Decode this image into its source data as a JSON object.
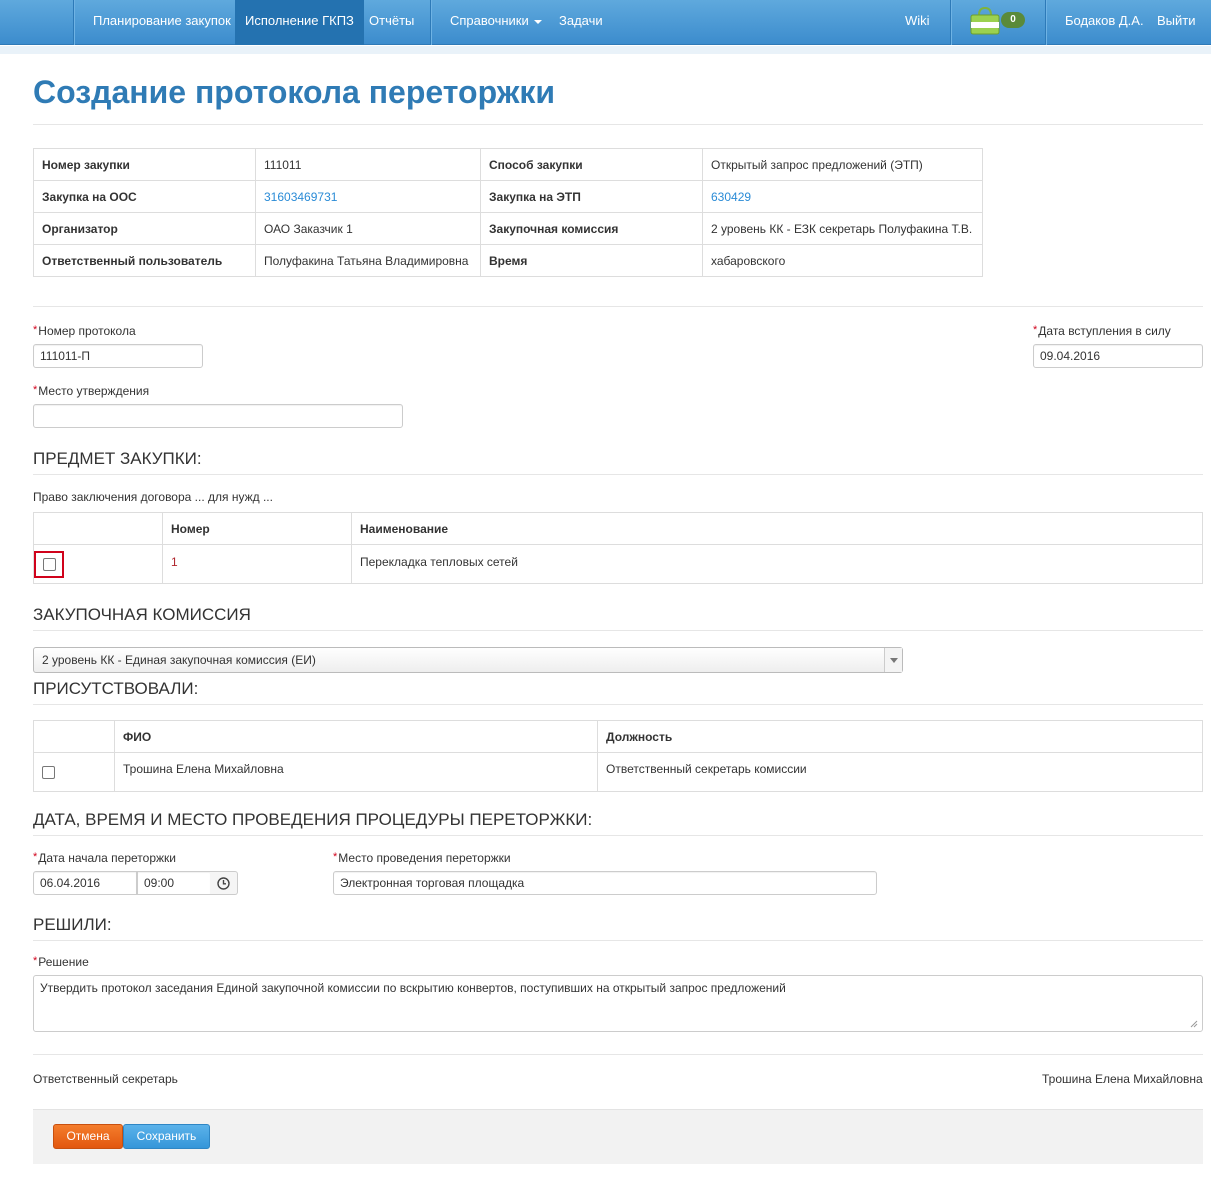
{
  "nav": {
    "items": [
      "Планирование закупок",
      "Исполнение ГКПЗ",
      "Отчёты",
      "Справочники",
      "Задачи"
    ],
    "wiki": "Wiki",
    "cart_count": "0",
    "user": "Бодаков Д.А.",
    "logout": "Выйти"
  },
  "page": {
    "title": "Создание протокола переторжки"
  },
  "info": {
    "rows": [
      [
        "Номер закупки",
        "111011",
        "Способ закупки",
        "Открытый запрос предложений (ЭТП)"
      ],
      [
        "Закупка на ООС",
        "31603469731",
        "Закупка на ЭТП",
        "630429"
      ],
      [
        "Организатор",
        "ОАО Заказчик 1",
        "Закупочная комиссия",
        "2 уровень КК - ЕЗК секретарь Полуфакина Т.В."
      ],
      [
        "Ответственный пользователь",
        "Полуфакина Татьяна Владимировна",
        "Время",
        "хабаровского"
      ]
    ]
  },
  "form": {
    "required_mark": "*",
    "protocol_number": {
      "label": "Номер протокола",
      "value": "111011-П"
    },
    "effective_date": {
      "label": "Дата вступления в силу",
      "value": "09.04.2016"
    },
    "approval_place": {
      "label": "Место утверждения",
      "value": ""
    }
  },
  "subject": {
    "heading": "ПРЕДМЕТ ЗАКУПКИ:",
    "description": "Право заключения договора ... для нужд ...",
    "columns": [
      "",
      "Номер",
      "Наименование"
    ],
    "rows": [
      {
        "number": "1",
        "name": "Перекладка тепловых сетей"
      }
    ]
  },
  "commission": {
    "heading": "ЗАКУПОЧНАЯ КОМИССИЯ",
    "selected": "2 уровень КК - Единая закупочная комиссия (ЕИ)"
  },
  "attended": {
    "heading": "ПРИСУТСТВОВАЛИ:",
    "columns": [
      "",
      "ФИО",
      "Должность"
    ],
    "rows": [
      {
        "name": "Трошина Елена Михайловна",
        "position": "Ответственный секретарь комиссии"
      }
    ]
  },
  "rebid": {
    "heading": "ДАТА, ВРЕМЯ И МЕСТО ПРОВЕДЕНИЯ ПРОЦЕДУРЫ ПЕРЕТОРЖКИ:",
    "start_label": "Дата начала переторжки",
    "start_date": "06.04.2016",
    "start_time": "09:00",
    "place_label": "Место проведения переторжки",
    "place_value": "Электронная торговая площадка"
  },
  "decided": {
    "heading": "РЕШИЛИ:",
    "label": "Решение",
    "value": "Утвердить протокол заседания Единой закупочной комиссии по вскрытию конвертов, поступивших на открытый запрос предложений"
  },
  "secretary": {
    "label": "Ответственный секретарь",
    "name": "Трошина Елена Михайловна"
  },
  "actions": {
    "cancel": "Отмена",
    "save": "Сохранить"
  },
  "colors": {
    "brand": "#3c8ccd",
    "title": "#2f7bb5",
    "link": "#2a8bd6",
    "cancel": "#e2570f",
    "save": "#3596d9",
    "required": "#d0021b"
  }
}
